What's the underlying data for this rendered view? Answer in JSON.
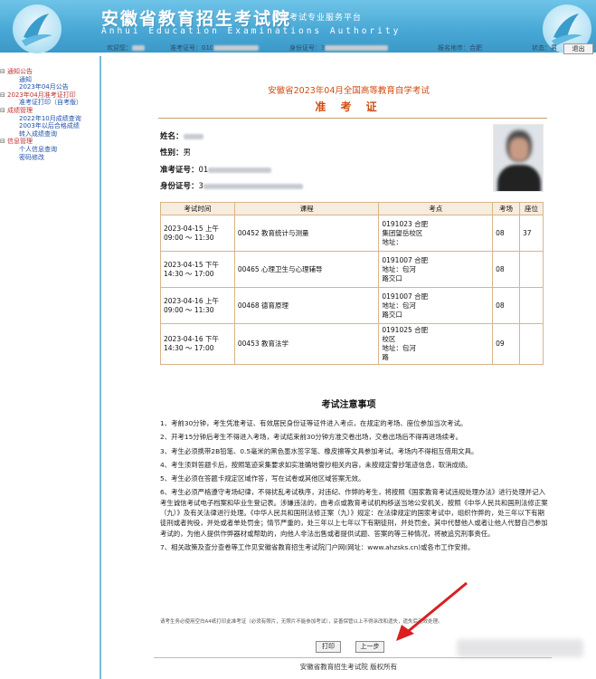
{
  "header": {
    "title": "安徽省教育招生考试院",
    "subtitle": "自学考试专业服务平台",
    "english": "Anhui Education Examinations Authority"
  },
  "userbar": {
    "welcome_label": "欢迎您：",
    "ticket_label": "准考证号：010",
    "id_label": "身份证号：3",
    "city_label": "报名地市：合肥",
    "status_label": "状态：男",
    "logout_label": "退出"
  },
  "sidebar": {
    "groups": [
      {
        "label": "通知公告",
        "items": [
          "通知",
          "2023年04月公告"
        ]
      },
      {
        "label": "2023年04月准考证打印",
        "items": [
          "准考证打印（自考版）"
        ]
      },
      {
        "label": "成绩管理",
        "items": [
          "2022年10月成绩查询",
          "2003年以后合格成绩",
          "转入成绩查询"
        ]
      },
      {
        "label": "信息管理",
        "items": [
          "个人信息查询",
          "密码修改"
        ]
      }
    ]
  },
  "ticket": {
    "exam_heading": "安徽省2023年04月全国高等教育自学考试",
    "title": "准 考 证",
    "name_label": "姓名：",
    "gender_label": "性别：",
    "gender_value": "男",
    "ticket_no_label": "准考证号：",
    "id_no_label": "身份证号：",
    "ticket_no_visible": "01",
    "id_no_visible": "3"
  },
  "schedule": {
    "headers": [
      "考试时间",
      "课程",
      "考点",
      "考场",
      "座位"
    ],
    "rows": [
      {
        "time": "2023-04-15 上午\n09:00 ～ 11:30",
        "course": "00452 教育统计与测量",
        "site": "0191023 合肥\n集团望岳校区\n地址：",
        "room": "08",
        "seat": "37"
      },
      {
        "time": "2023-04-15 下午\n14:30 ～ 17:00",
        "course": "00465 心理卫生与心理辅导",
        "site": "0191007 合肥\n地址：包河\n路交口",
        "room": "08",
        "seat": ""
      },
      {
        "time": "2023-04-16 上午\n09:00 ～ 11:30",
        "course": "00468 德育原理",
        "site": "0191007 合肥\n地址：包河\n路交口",
        "room": "08",
        "seat": ""
      },
      {
        "time": "2023-04-16 下午\n14:30 ～ 17:00",
        "course": "00453 教育法学",
        "site": "0191025 合肥\n校区\n地址：包河\n路",
        "room": "09",
        "seat": ""
      }
    ]
  },
  "notes": {
    "title": "考试注意事项",
    "items": [
      "1、考前30分钟，考生凭准考证、有效居民身份证等证件进入考点，在规定的考场、座位参加当次考试。",
      "2、开考15分钟后考生不得进入考场，考试结束前30分钟方准交卷出场，交卷出场后不得再进场续考。",
      "3、考生必须携带2B铅笔、0.5毫米的黑色墨水签字笔、橡皮擦等文具参加考试。考场内不得相互借用文具。",
      "4、考生须到答题卡后，按照笔迹采集要求如实准确地誊抄相关内容，未按规定誊抄笔迹信息，取消成绩。",
      "5、考生必须在答题卡规定区域作答，写在试卷或其他区域答案无效。",
      "6、考生必须严格遵守考场纪律，不得扰乱考试秩序，对违纪、作弊的考生，将按照《国家教育考试违规处理办法》进行处理并记入考生诚信考试电子档案和毕业生登记表。涉嫌违法的，由考点或教育考试机构移送当地公安机关，按照《中华人民共和国刑法修正案（九）》及有关法律进行处理。《中华人民共和国刑法修正案（九）》规定：在法律规定的国家考试中，组织作弊的，处三年以下有期徒刑或者拘役，并处或者单处罚金；情节严重的，处三年以上七年以下有期徒刑，并处罚金。其中代替他人或者让他人代替自己参加考试的，为他人提供作弊器材或帮助的，向他人非法出售或者提供试题、答案的等三种情况，将被追究刑事责任。",
      "7、相关政策及查分查卷等工作见安徽省教育招生考试院门户网(网址：www.ahzsks.cn)或各市工作安排。"
    ]
  },
  "footnote": "请考生务必使用空白A4纸打印此准考证（必须有照片，无照片不能参加考试），妥善保管以上不得涂改和遗失，遗失后无效处理。",
  "buttons": {
    "print": "打印",
    "back": "上一步"
  },
  "copyright": "安徽省教育招生考试院 版权所有"
}
